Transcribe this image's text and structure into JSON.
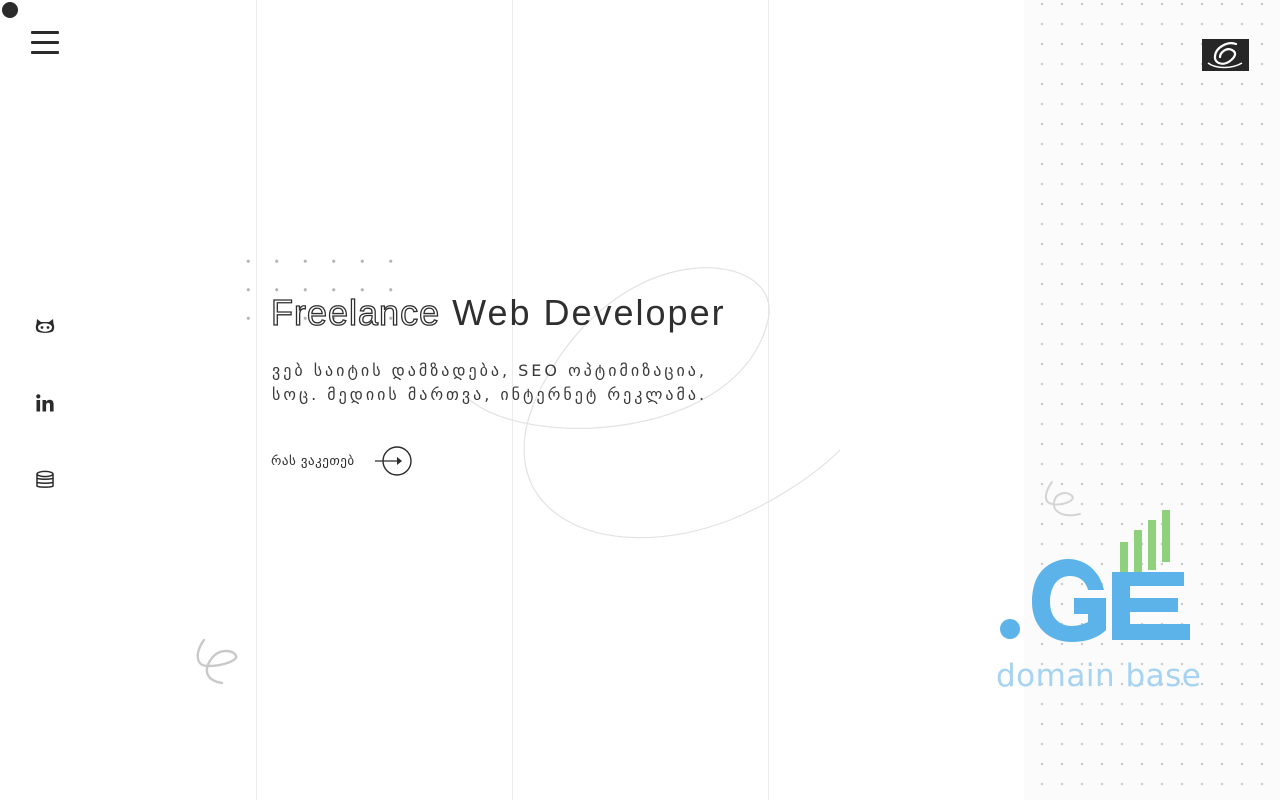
{
  "header": {
    "menu_icon": "hamburger-menu-icon",
    "logo_icon": "e-logo-icon"
  },
  "social": [
    {
      "icon": "github-icon"
    },
    {
      "icon": "linkedin-icon"
    },
    {
      "icon": "database-icon"
    }
  ],
  "hero": {
    "title_outline": "Freelance",
    "title_rest": "Web Developer",
    "subtitle_line1": "ვებ საიტის დამზადება, SEO ოპტიმიზაცია,",
    "subtitle_line2": "სოც. მედიის მართვა, ინტერნეტ რეკლამა.",
    "cta_label": "რას ვაკეთებ"
  },
  "promo": {
    "tld": ".GE",
    "caption": "domain base",
    "colors": {
      "blue": "#5bb3ea",
      "green": "#8ed07b",
      "caption": "#a5d3f1"
    }
  }
}
